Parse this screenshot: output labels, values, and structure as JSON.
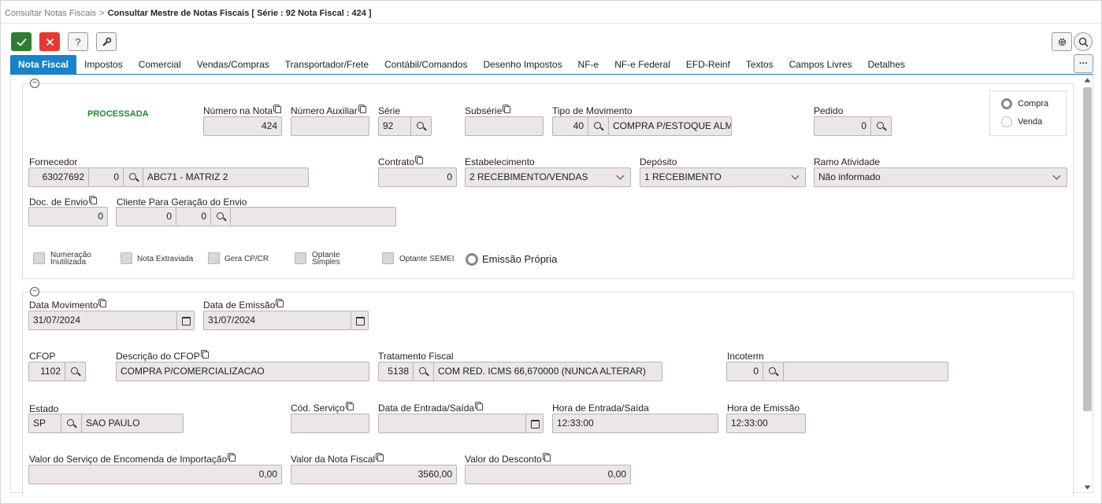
{
  "breadcrumb": {
    "parent": "Consultar Notas Fiscais",
    "separator": ">",
    "current": "Consultar Mestre de Notas Fiscais [ Série : 92 Nota Fiscal : 424 ]"
  },
  "toolbar": {
    "confirm_icon": "check-icon",
    "cancel_icon": "close-icon",
    "help_label": "?",
    "tool_icon": "wrench-icon",
    "settings_icon": "gear-icon",
    "search_icon": "search-icon",
    "more_label": "···"
  },
  "colors": {
    "accent": "#1a82c8",
    "confirm": "#2e7d32",
    "cancel": "#e53935",
    "status": "#1c8c2e",
    "field_bg": "#ece6e6"
  },
  "tabs": [
    {
      "label": "Nota Fiscal",
      "active": true
    },
    {
      "label": "Impostos"
    },
    {
      "label": "Comercial"
    },
    {
      "label": "Vendas/Compras"
    },
    {
      "label": "Transportador/Frete"
    },
    {
      "label": "Contábil/Comandos"
    },
    {
      "label": "Desenho Impostos"
    },
    {
      "label": "NF-e"
    },
    {
      "label": "NF-e Federal"
    },
    {
      "label": "EFD-Reinf"
    },
    {
      "label": "Textos"
    },
    {
      "label": "Campos Livres"
    },
    {
      "label": "Detalhes"
    }
  ],
  "section1": {
    "collapse_symbol": "−",
    "status": "PROCESSADA",
    "numero_nota": {
      "label": "Número na Nota",
      "value": "424"
    },
    "numero_auxiliar": {
      "label": "Número Auxiliar",
      "value": ""
    },
    "serie": {
      "label": "Série",
      "value": "92"
    },
    "subserie": {
      "label": "Subsérie",
      "value": ""
    },
    "tipo_movimento": {
      "label": "Tipo de Movimento",
      "code": "40",
      "description": "COMPRA P/ESTOQUE ALMOX"
    },
    "pedido": {
      "label": "Pedido",
      "value": "0"
    },
    "tipo_operacao": {
      "compra_label": "Compra",
      "venda_label": "Venda",
      "selected": "Compra"
    },
    "fornecedor": {
      "label": "Fornecedor",
      "code": "63027692",
      "sub": "0",
      "name": "ABC71 - MATRIZ 2"
    },
    "contrato": {
      "label": "Contrato",
      "value": "0"
    },
    "estabelecimento": {
      "label": "Estabelecimento",
      "value": "2 RECEBIMENTO/VENDAS"
    },
    "deposito": {
      "label": "Depósito",
      "value": "1 RECEBIMENTO"
    },
    "ramo_atividade": {
      "label": "Ramo Atividade",
      "value": "Não informado"
    },
    "doc_envio": {
      "label": "Doc. de Envio",
      "value": "0"
    },
    "cliente_envio": {
      "label": "Cliente Para Geração do Envio",
      "code": "0",
      "sub": "0",
      "name": ""
    },
    "checkboxes": [
      {
        "line1": "Numeração",
        "line2": "Inutilizada"
      },
      {
        "line1": "Nota Extraviada",
        "line2": ""
      },
      {
        "line1": "Gera CP/CR",
        "line2": ""
      },
      {
        "line1": "Optante",
        "line2": "Simples"
      },
      {
        "line1": "Optante SEMEI",
        "line2": ""
      }
    ],
    "emissao_propria": "Emissão Própria"
  },
  "section2": {
    "collapse_symbol": "−",
    "data_movimento": {
      "label": "Data Movimento",
      "value": "31/07/2024"
    },
    "data_emissao": {
      "label": "Data de Emissão",
      "value": "31/07/2024"
    },
    "cfop": {
      "label": "CFOP",
      "value": "1102"
    },
    "descricao_cfop": {
      "label": "Descrição do CFOP",
      "value": "COMPRA P/COMERCIALIZACAO"
    },
    "tratamento_fiscal": {
      "label": "Tratamento Fiscal",
      "code": "5138",
      "description": "COM RED. ICMS 66,670000 (NUNCA ALTERAR)"
    },
    "incoterm": {
      "label": "Incoterm",
      "code": "0",
      "description": ""
    },
    "estado": {
      "label": "Estado",
      "code": "SP",
      "name": "SAO PAULO"
    },
    "cod_servico": {
      "label": "Cód. Serviço",
      "value": ""
    },
    "data_entrada_saida": {
      "label": "Data de Entrada/Saída",
      "value": ""
    },
    "hora_entrada_saida": {
      "label": "Hora de Entrada/Saída",
      "value": "12:33:00"
    },
    "hora_emissao": {
      "label": "Hora de Emissão",
      "value": "12:33:00"
    },
    "valor_servico_importacao": {
      "label": "Valor do Serviço de Encomenda de Importação",
      "value": "0,00"
    },
    "valor_nota_fiscal": {
      "label": "Valor da Nota Fiscal",
      "value": "3560,00"
    },
    "valor_desconto": {
      "label": "Valor do Desconto",
      "value": "0,00"
    }
  }
}
